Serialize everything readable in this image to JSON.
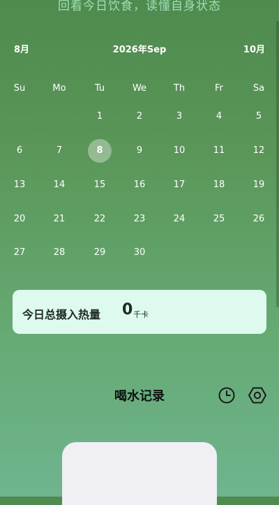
{
  "header": {
    "caption": "回看今日饮食，读懂自身状态"
  },
  "calendar": {
    "prev_month_label": "8月",
    "current_month_label": "2026年Sep",
    "next_month_label": "10月",
    "weekdays": [
      "Su",
      "Mo",
      "Tu",
      "We",
      "Th",
      "Fr",
      "Sa"
    ],
    "selected_day": "8",
    "weeks": [
      [
        "",
        "",
        "1",
        "2",
        "3",
        "4",
        "5"
      ],
      [
        "6",
        "7",
        "8",
        "9",
        "10",
        "11",
        "12"
      ],
      [
        "13",
        "14",
        "15",
        "16",
        "17",
        "18",
        "19"
      ],
      [
        "20",
        "21",
        "22",
        "23",
        "24",
        "25",
        "26"
      ],
      [
        "27",
        "28",
        "29",
        "30",
        "",
        "",
        ""
      ]
    ]
  },
  "calories": {
    "label": "今日总摄入热量",
    "value": "0",
    "unit": "千卡"
  },
  "water": {
    "title": "喝水记录",
    "history_icon": "clock-icon",
    "settings_icon": "hexagon-settings-icon"
  },
  "colors": {
    "card_bg": "#defaee",
    "caption": "#9be0b5",
    "panel_bg": "#f0eff4"
  }
}
